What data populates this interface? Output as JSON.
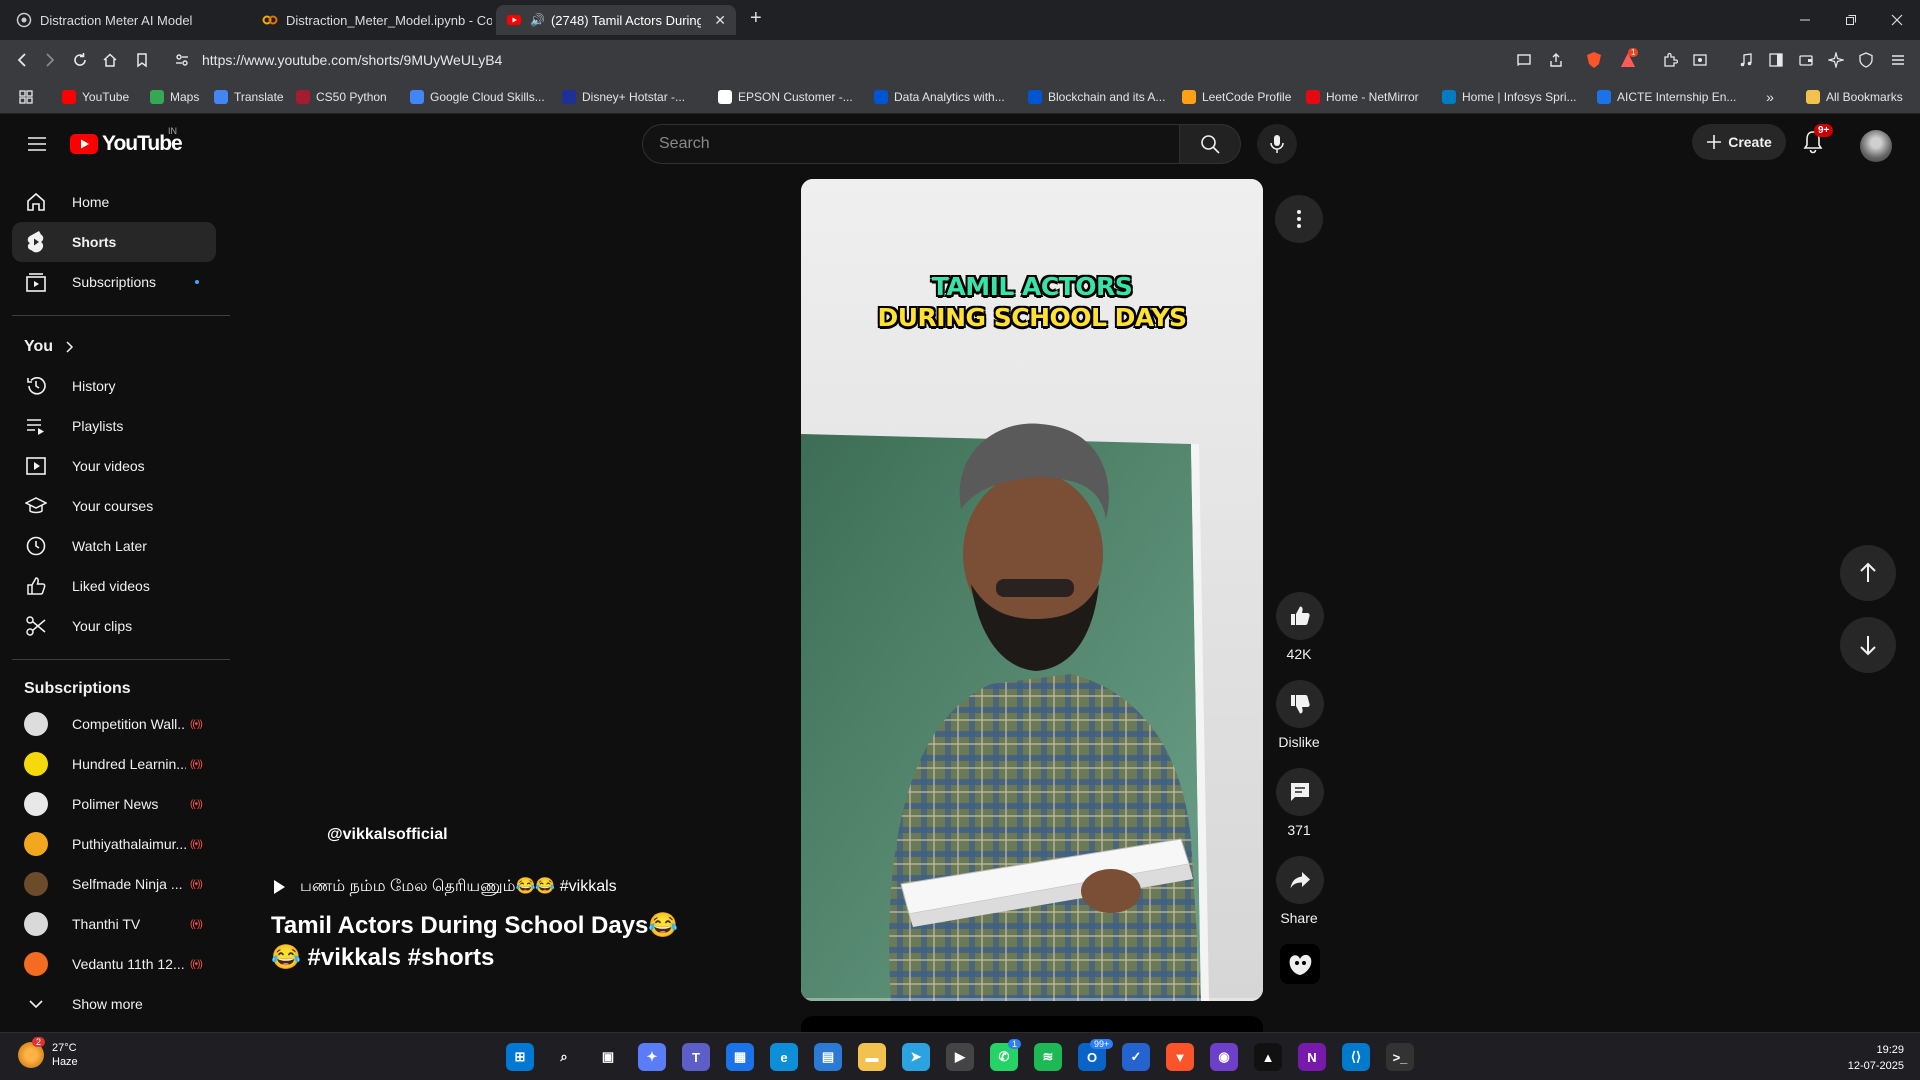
{
  "browser": {
    "tabs": [
      {
        "title": "Distraction Meter AI Model",
        "icon": "globe-icon"
      },
      {
        "title": "Distraction_Meter_Model.ipynb - Col",
        "icon": "colab-icon"
      },
      {
        "title": "(2748) Tamil Actors During Sc",
        "icon": "youtube-icon",
        "audio": true
      }
    ],
    "url": "https://www.youtube.com/shorts/9MUyWeULyB4",
    "bookmarks": [
      {
        "label": "YouTube",
        "color": "#ff0000"
      },
      {
        "label": "Maps",
        "color": "#34a853"
      },
      {
        "label": "Translate",
        "color": "#4285f4"
      },
      {
        "label": "CS50 Python",
        "color": "#a51c30"
      },
      {
        "label": "Google Cloud Skills...",
        "color": "#4285f4"
      },
      {
        "label": "Disney+ Hotstar -...",
        "color": "#1f2f98"
      },
      {
        "label": "EPSON Customer -...",
        "color": "#ffffff"
      },
      {
        "label": "Data Analytics with...",
        "color": "#0056d2"
      },
      {
        "label": "Blockchain and its A...",
        "color": "#0056d2"
      },
      {
        "label": "LeetCode Profile",
        "color": "#ffa116"
      },
      {
        "label": "Home - NetMirror",
        "color": "#e50914"
      },
      {
        "label": "Home | Infosys Spri...",
        "color": "#007cc3"
      },
      {
        "label": "AICTE Internship En...",
        "color": "#1a73e8"
      }
    ],
    "all_bookmarks": "All Bookmarks",
    "extension_badge": "1"
  },
  "masthead": {
    "logo": "YouTube",
    "country": "IN",
    "search_placeholder": "Search",
    "create_label": "Create",
    "notifications_badge": "9+"
  },
  "sidebar": {
    "main": [
      {
        "label": "Home",
        "icon": "home-icon"
      },
      {
        "label": "Shorts",
        "icon": "shorts-icon",
        "active": true
      },
      {
        "label": "Subscriptions",
        "icon": "subscriptions-icon",
        "dot": true
      }
    ],
    "you_title": "You",
    "you": [
      {
        "label": "History",
        "icon": "history-icon"
      },
      {
        "label": "Playlists",
        "icon": "playlists-icon"
      },
      {
        "label": "Your videos",
        "icon": "your-videos-icon"
      },
      {
        "label": "Your courses",
        "icon": "courses-icon"
      },
      {
        "label": "Watch Later",
        "icon": "clock-icon"
      },
      {
        "label": "Liked videos",
        "icon": "thumbs-up-icon"
      },
      {
        "label": "Your clips",
        "icon": "scissors-icon"
      }
    ],
    "subscriptions_title": "Subscriptions",
    "subscriptions": [
      {
        "name": "Competition Wall...",
        "color": "#ddd"
      },
      {
        "name": "Hundred Learnin...",
        "color": "#f5d90a"
      },
      {
        "name": "Polimer News",
        "color": "#e8e8e8"
      },
      {
        "name": "Puthiyathalaimur...",
        "color": "#f2a81d"
      },
      {
        "name": "Selfmade Ninja ...",
        "color": "#6b4b2a"
      },
      {
        "name": "Thanthi TV",
        "color": "#d9d9d9"
      },
      {
        "name": "Vedantu 11th 12...",
        "color": "#f36c21"
      }
    ],
    "live_mark": "((•))",
    "show_more": "Show more"
  },
  "short": {
    "overlay_line1": "TAMIL ACTORS",
    "overlay_line2": "DURING SCHOOL DAYS",
    "channel": "@vikkalsofficial",
    "description": "பணம் நம்ம மேல தெரியணும்😂😂 #vikkals",
    "title": "Tamil Actors During School Days😂 😂 #vikkals #shorts",
    "likes": "42K",
    "dislike_label": "Dislike",
    "comments": "371",
    "share_label": "Share",
    "progress": 0.01
  },
  "taskbar": {
    "weather_temp": "27°C",
    "weather_desc": "Haze",
    "weather_badge": "2",
    "time": "19:29",
    "date": "12-07-2025",
    "whatsapp_badge": "1",
    "outlook_badge": "99+",
    "apps": [
      {
        "name": "windows-start-icon",
        "color": "#0078d4",
        "glyph": "⊞"
      },
      {
        "name": "search-icon",
        "color": "transparent",
        "glyph": "⌕"
      },
      {
        "name": "task-view-icon",
        "color": "transparent",
        "glyph": "▣"
      },
      {
        "name": "copilot-icon",
        "color": "#5b7cf7",
        "glyph": "✦"
      },
      {
        "name": "teams-icon",
        "color": "#5b5fc7",
        "glyph": "T"
      },
      {
        "name": "widgets-icon",
        "color": "#1a73e8",
        "glyph": "▦"
      },
      {
        "name": "edge-icon",
        "color": "#0c8ed9",
        "glyph": "e"
      },
      {
        "name": "store-icon",
        "color": "#2b7bd6",
        "glyph": "▤"
      },
      {
        "name": "file-explorer-icon",
        "color": "#f2c14e",
        "glyph": "▬"
      },
      {
        "name": "telegram-icon",
        "color": "#2aa3e0",
        "glyph": "➤"
      },
      {
        "name": "media-player-icon",
        "color": "#444",
        "glyph": "▶"
      },
      {
        "name": "whatsapp-icon",
        "color": "#25d366",
        "glyph": "✆"
      },
      {
        "name": "spotify-icon",
        "color": "#1db954",
        "glyph": "≋"
      },
      {
        "name": "outlook-icon",
        "color": "#0a64c8",
        "glyph": "O"
      },
      {
        "name": "todo-icon",
        "color": "#2564cf",
        "glyph": "✓"
      },
      {
        "name": "brave-icon",
        "color": "#fb542b",
        "glyph": "▼"
      },
      {
        "name": "github-desktop-icon",
        "color": "#6e40c9",
        "glyph": "◉"
      },
      {
        "name": "arc-icon",
        "color": "#111",
        "glyph": "▲"
      },
      {
        "name": "onenote-icon",
        "color": "#7719aa",
        "glyph": "N"
      },
      {
        "name": "vscode-icon",
        "color": "#007acc",
        "glyph": "⟨⟩"
      },
      {
        "name": "terminal-icon",
        "color": "#333",
        "glyph": ">_"
      }
    ]
  }
}
